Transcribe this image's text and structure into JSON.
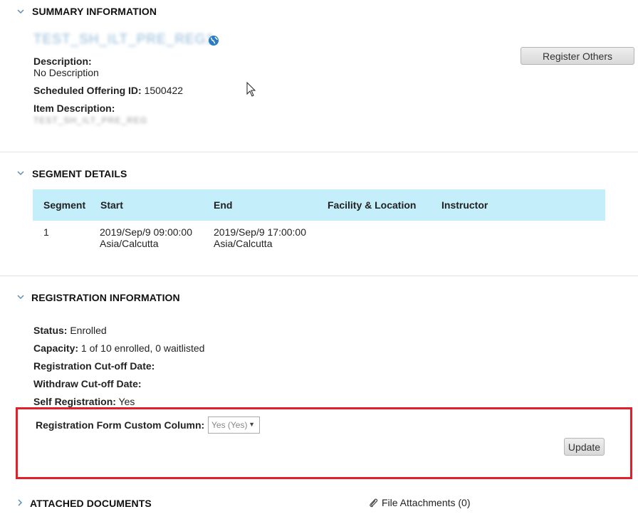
{
  "summary": {
    "title": "SUMMARY INFORMATION",
    "offering_name": "TEST_SH_ILT_PRE_REG1",
    "description_label": "Description:",
    "description_value": "No Description",
    "offering_id_label": "Scheduled Offering ID:",
    "offering_id_value": "1500422",
    "item_description_label": "Item Description:",
    "item_description_value": "TEST_SH_ILT_PRE_REG",
    "register_others_button": "Register Others"
  },
  "segment": {
    "title": "SEGMENT DETAILS",
    "columns": [
      "Segment",
      "Start",
      "End",
      "Facility & Location",
      "Instructor"
    ],
    "rows": [
      {
        "segment": "1",
        "start_date": "2019/Sep/9 09:00:00",
        "start_tz": "Asia/Calcutta",
        "end_date": "2019/Sep/9 17:00:00",
        "end_tz": "Asia/Calcutta",
        "facility": "",
        "instructor": ""
      }
    ]
  },
  "registration": {
    "title": "REGISTRATION INFORMATION",
    "status_label": "Status:",
    "status_value": "Enrolled",
    "capacity_label": "Capacity:",
    "capacity_value": "1 of 10 enrolled, 0 waitlisted",
    "reg_cutoff_label": "Registration Cut-off Date:",
    "withdraw_cutoff_label": "Withdraw Cut-off Date:",
    "self_reg_label": "Self Registration:",
    "self_reg_value": "Yes",
    "custom_column_label": "Registration Form Custom Column:",
    "custom_column_selected": "Yes (Yes)",
    "update_button": "Update"
  },
  "attached": {
    "title": "ATTACHED DOCUMENTS",
    "file_attachments": "File Attachments (0)"
  },
  "colors": {
    "table_header_bg": "#c3eefa",
    "highlight_border": "#e0202a"
  }
}
